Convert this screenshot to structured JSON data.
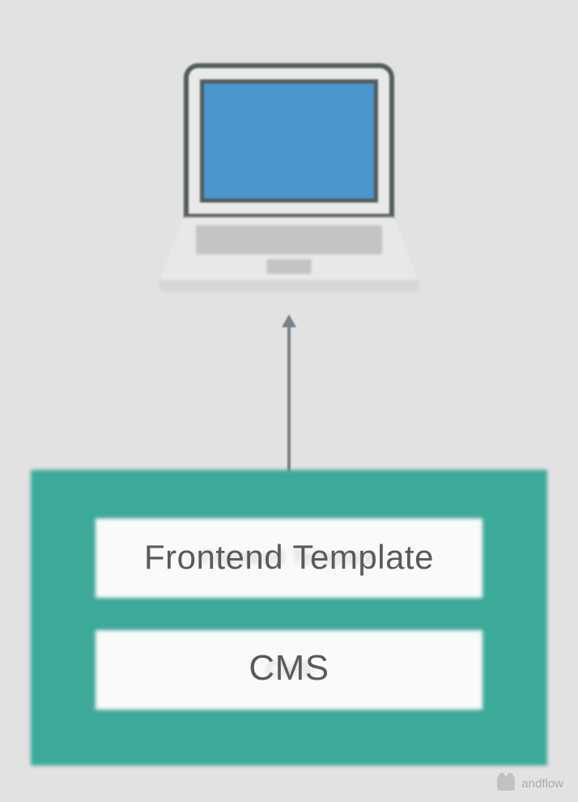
{
  "diagram": {
    "nodes": {
      "client": "laptop",
      "container": {
        "blocks": [
          {
            "label": "Frontend Template",
            "ghost": "Frontend Template"
          },
          {
            "label": "CMS",
            "ghost": "CMS"
          }
        ]
      }
    },
    "edges": [
      {
        "from": "container",
        "to": "client",
        "direction": "up"
      }
    ]
  },
  "colors": {
    "background": "#e2e2e2",
    "container": "#3daa99",
    "screen": "#4a96cf",
    "text": "#5a5a5a"
  },
  "watermark": {
    "icon": "wechat",
    "text": "andflow"
  }
}
